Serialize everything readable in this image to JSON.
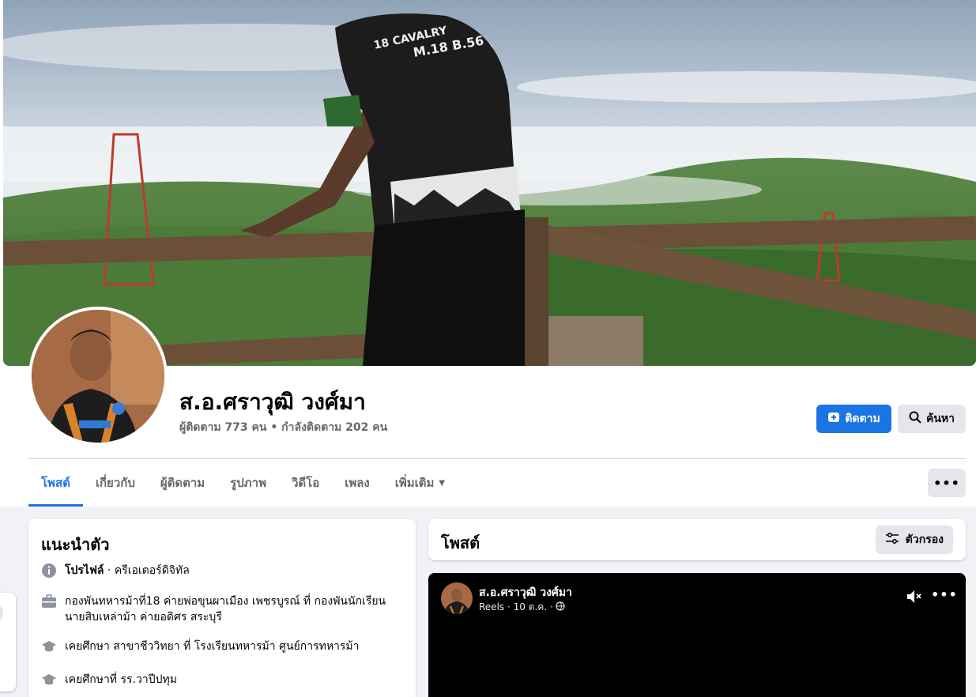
{
  "profile": {
    "name": "ส.อ.ศราวุฒิ วงศ์มา",
    "followers_text": "ผู้ติดตาม 773 คน • กำลังติดตาม 202 คน"
  },
  "actions": {
    "follow_label": "ติดตาม",
    "search_label": "ค้นหา"
  },
  "tabs": [
    {
      "label": "โพสต์"
    },
    {
      "label": "เกี่ยวกับ"
    },
    {
      "label": "ผู้ติดตาม"
    },
    {
      "label": "รูปภาพ"
    },
    {
      "label": "วิดีโอ"
    },
    {
      "label": "เพลง"
    },
    {
      "label": "เพิ่มเติม"
    }
  ],
  "more_label": "•••",
  "intro": {
    "title": "แนะนำตัว",
    "items": [
      {
        "icon": "info-icon",
        "label": "โปรไฟล์",
        "text": " · ครีเอเตอร์ดิจิทัล"
      },
      {
        "icon": "briefcase-icon",
        "text": "กองพันทหารม้าที่18 ค่ายพ่อขุนผาเมือง เพชรบูรณ์ ที่ กองพันนักเรียนนายสิบเหล่าม้า ค่ายอดิศร สระบุรี"
      },
      {
        "icon": "graduation-cap-icon",
        "text": "เคยศึกษา สาขาชีววิทยา ที่ โรงเรียนทหารม้า ศูนย์การทหารม้า"
      },
      {
        "icon": "graduation-cap-icon",
        "text": "เคยศึกษาที่ รร.วาปีปทุม"
      }
    ]
  },
  "posts": {
    "title": "โพสต์",
    "filter_label": "ตัวกรอง"
  },
  "reel": {
    "author": "ส.อ.ศราวุฒิ วงศ์มา",
    "meta": "Reels · 10 ต.ค. ·",
    "more": "•••"
  },
  "colors": {
    "accent": "#1b74e4",
    "secondary_button": "#e4e6eb",
    "muted_text": "#65676b",
    "page_bg": "#f0f2f5"
  }
}
